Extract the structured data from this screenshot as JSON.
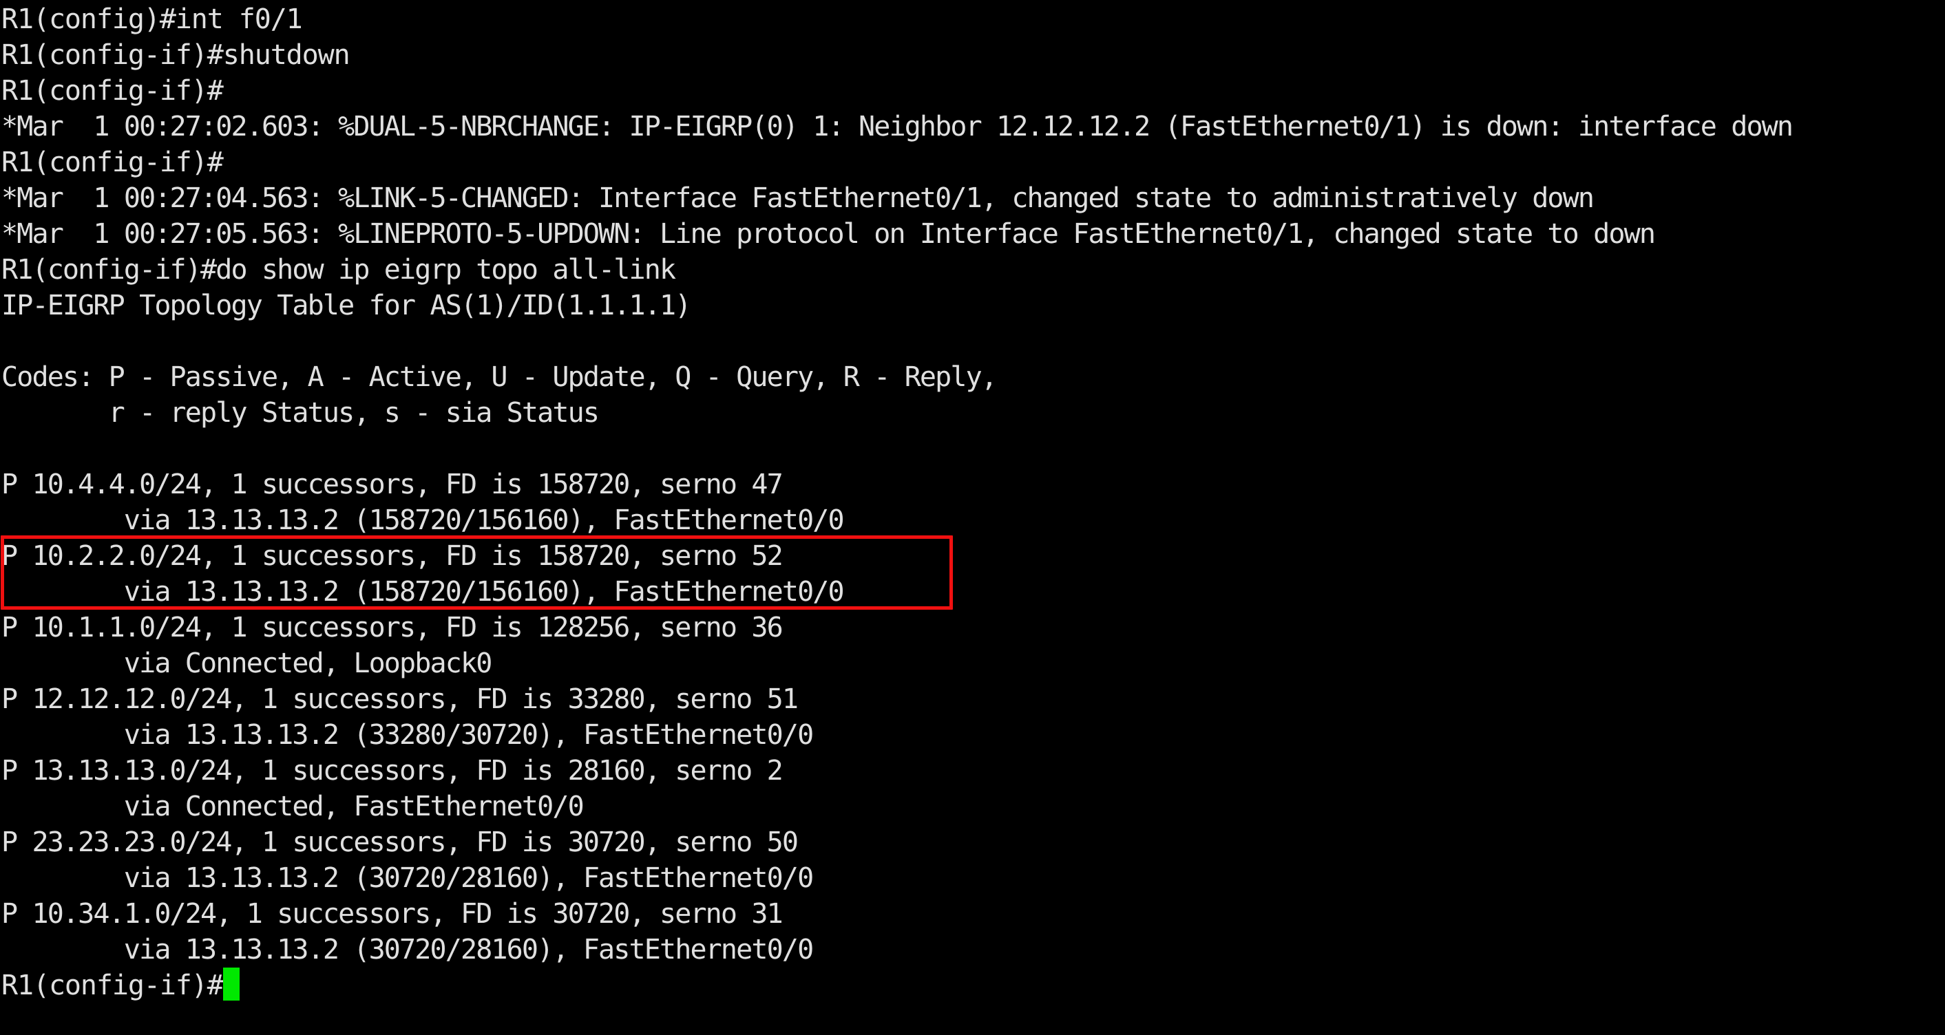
{
  "terminal": {
    "background_color": "#000000",
    "text_color": "#e0e0e0",
    "cursor_color": "#00e800",
    "highlight_color": "#f01010",
    "device_hostname": "R1",
    "lines": [
      "R1(config)#int f0/1",
      "R1(config-if)#shutdown",
      "R1(config-if)#",
      "*Mar  1 00:27:02.603: %DUAL-5-NBRCHANGE: IP-EIGRP(0) 1: Neighbor 12.12.12.2 (FastEthernet0/1) is down: interface down",
      "R1(config-if)#",
      "*Mar  1 00:27:04.563: %LINK-5-CHANGED: Interface FastEthernet0/1, changed state to administratively down",
      "*Mar  1 00:27:05.563: %LINEPROTO-5-UPDOWN: Line protocol on Interface FastEthernet0/1, changed state to down",
      "R1(config-if)#do show ip eigrp topo all-link",
      "IP-EIGRP Topology Table for AS(1)/ID(1.1.1.1)",
      "",
      "Codes: P - Passive, A - Active, U - Update, Q - Query, R - Reply,",
      "       r - reply Status, s - sia Status",
      "",
      "P 10.4.4.0/24, 1 successors, FD is 158720, serno 47",
      "        via 13.13.13.2 (158720/156160), FastEthernet0/0",
      "P 10.2.2.0/24, 1 successors, FD is 158720, serno 52",
      "        via 13.13.13.2 (158720/156160), FastEthernet0/0",
      "P 10.1.1.0/24, 1 successors, FD is 128256, serno 36",
      "        via Connected, Loopback0",
      "P 12.12.12.0/24, 1 successors, FD is 33280, serno 51",
      "        via 13.13.13.2 (33280/30720), FastEthernet0/0",
      "P 13.13.13.0/24, 1 successors, FD is 28160, serno 2",
      "        via Connected, FastEthernet0/0",
      "P 23.23.23.0/24, 1 successors, FD is 30720, serno 50",
      "        via 13.13.13.2 (30720/28160), FastEthernet0/0",
      "P 10.34.1.0/24, 1 successors, FD is 30720, serno 31",
      "        via 13.13.13.2 (30720/28160), FastEthernet0/0"
    ],
    "final_prompt": "R1(config-if)#",
    "highlight_annotation": {
      "label": "red-rectangle-annotation",
      "highlighted_lines": [
        "P 10.2.2.0/24, 1 successors, FD is 158720, serno 52",
        "        via 13.13.13.2 (158720/156160), FastEthernet0/0"
      ]
    }
  }
}
